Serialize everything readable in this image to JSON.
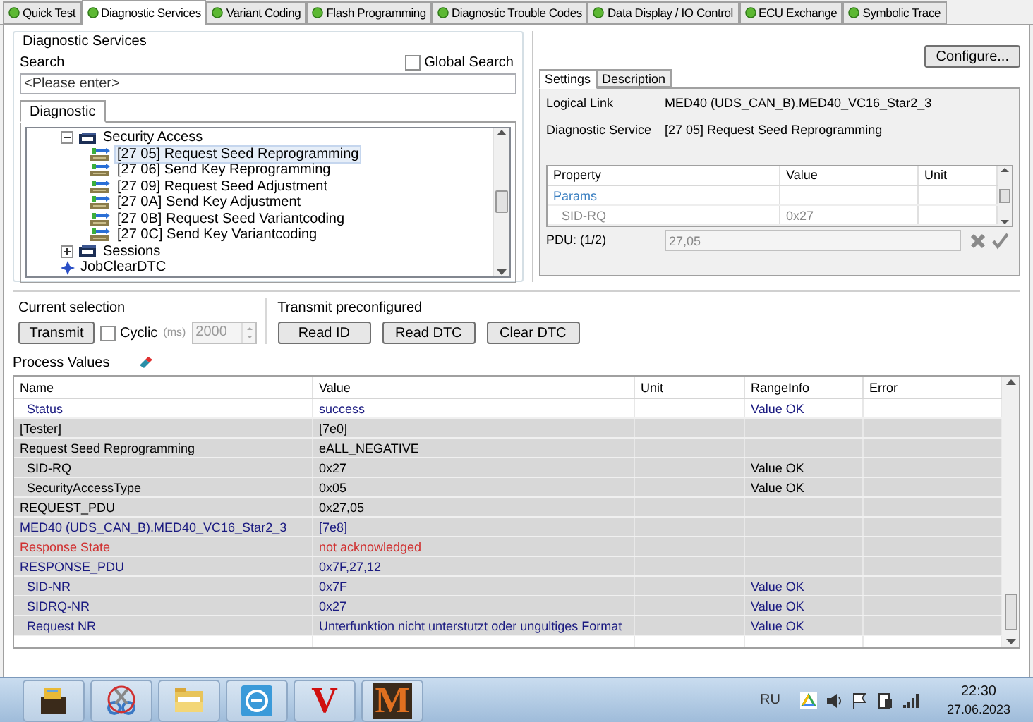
{
  "tabs": [
    {
      "label": "Quick Test",
      "selected": false
    },
    {
      "label": "Diagnostic Services",
      "selected": true
    },
    {
      "label": "Variant Coding",
      "selected": false
    },
    {
      "label": "Flash Programming",
      "selected": false
    },
    {
      "label": "Diagnostic Trouble Codes",
      "selected": false
    },
    {
      "label": "Data Display / IO Control",
      "selected": false
    },
    {
      "label": "ECU Exchange",
      "selected": false
    },
    {
      "label": "Symbolic Trace",
      "selected": false
    }
  ],
  "services": {
    "title": "Diagnostic Services",
    "search_label": "Search",
    "global_search": {
      "label": "Global Search",
      "checked": false
    },
    "search_placeholder": "<Please enter>",
    "tree_tab": "Diagnostic",
    "tree": [
      {
        "label": "Security Access",
        "kind": "folder",
        "expanded": true,
        "children": [
          {
            "label": "[27 05] Request Seed Reprogramming",
            "kind": "service",
            "selected": true
          },
          {
            "label": "[27 06] Send Key Reprogramming",
            "kind": "service",
            "selected": false
          },
          {
            "label": "[27 09] Request Seed Adjustment",
            "kind": "service",
            "selected": false
          },
          {
            "label": "[27 0A] Send Key Adjustment",
            "kind": "service",
            "selected": false
          },
          {
            "label": "[27 0B] Request Seed Variantcoding",
            "kind": "service",
            "selected": false
          },
          {
            "label": "[27 0C] Send Key Variantcoding",
            "kind": "service",
            "selected": false
          }
        ]
      },
      {
        "label": "Sessions",
        "kind": "folder",
        "expanded": false
      },
      {
        "label": "JobClearDTC",
        "kind": "job"
      }
    ]
  },
  "details": {
    "configure": "Configure...",
    "tabs": [
      {
        "label": "Settings",
        "selected": true
      },
      {
        "label": "Description",
        "selected": false
      }
    ],
    "fields": [
      {
        "label": "Logical Link",
        "value": "MED40 (UDS_CAN_B).MED40_VC16_Star2_3"
      },
      {
        "label": "Diagnostic Service",
        "value": "[27 05] Request Seed Reprogramming"
      }
    ],
    "grid": {
      "columns": [
        "Property",
        "Value",
        "Unit"
      ],
      "rows": [
        {
          "kind": "category",
          "cells": [
            "Params",
            "",
            ""
          ]
        },
        {
          "kind": "param",
          "cells": [
            "SID-RQ",
            "0x27",
            ""
          ]
        }
      ]
    },
    "pdu_label": "PDU: (1/2)",
    "pdu_value": "27,05"
  },
  "current_selection": {
    "title": "Current selection",
    "transmit": "Transmit",
    "cyclic": {
      "label": "Cyclic",
      "checked": false
    },
    "unit": "(ms)",
    "interval": "2000"
  },
  "preconfigured": {
    "title": "Transmit preconfigured",
    "buttons": [
      "Read ID",
      "Read DTC",
      "Clear DTC"
    ]
  },
  "process_values": {
    "title": "Process Values",
    "columns": [
      "Name",
      "Value",
      "Unit",
      "RangeInfo",
      "Error"
    ],
    "rows": [
      {
        "kind": "param",
        "shaded": false,
        "color": "#1a1a80",
        "cells": [
          "Status",
          "success",
          "",
          "Value OK",
          ""
        ]
      },
      {
        "kind": "group",
        "shaded": true,
        "color": "#000000",
        "cells": [
          "[Tester]",
          "[7e0]",
          "",
          "",
          ""
        ]
      },
      {
        "kind": "group",
        "shaded": true,
        "color": "#000000",
        "cells": [
          "Request Seed Reprogramming",
          "eALL_NEGATIVE",
          "",
          "",
          ""
        ]
      },
      {
        "kind": "param",
        "shaded": true,
        "color": "#000000",
        "cells": [
          "SID-RQ",
          "0x27",
          "",
          "Value OK",
          ""
        ]
      },
      {
        "kind": "param",
        "shaded": true,
        "color": "#000000",
        "cells": [
          "SecurityAccessType",
          "0x05",
          "",
          "Value OK",
          ""
        ]
      },
      {
        "kind": "group",
        "shaded": true,
        "color": "#000000",
        "cells": [
          "REQUEST_PDU",
          "0x27,05",
          "",
          "",
          ""
        ]
      },
      {
        "kind": "group",
        "shaded": true,
        "color": "#1a1a80",
        "cells": [
          "MED40 (UDS_CAN_B).MED40_VC16_Star2_3",
          "[7e8]",
          "",
          "",
          ""
        ]
      },
      {
        "kind": "group",
        "shaded": true,
        "color": "#d03030",
        "cells": [
          "Response State",
          "not acknowledged",
          "",
          "",
          ""
        ]
      },
      {
        "kind": "group",
        "shaded": true,
        "color": "#1a1a80",
        "cells": [
          "RESPONSE_PDU",
          "0x7F,27,12",
          "",
          "",
          ""
        ]
      },
      {
        "kind": "param",
        "shaded": true,
        "color": "#1a1a80",
        "cells": [
          "SID-NR",
          "0x7F",
          "",
          "Value OK",
          ""
        ]
      },
      {
        "kind": "param",
        "shaded": true,
        "color": "#1a1a80",
        "cells": [
          "SIDRQ-NR",
          "0x27",
          "",
          "Value OK",
          ""
        ]
      },
      {
        "kind": "param",
        "shaded": true,
        "color": "#1a1a80",
        "cells": [
          "Request NR",
          "Unterfunktion nicht unterstutzt oder ungultiges Format",
          "",
          "Value OK",
          ""
        ]
      }
    ]
  },
  "taskbar": {
    "apps": [
      {
        "kind": "toolbox"
      },
      {
        "kind": "scissors"
      },
      {
        "kind": "folder"
      },
      {
        "kind": "minus"
      },
      {
        "kind": "letter",
        "label": "V"
      },
      {
        "kind": "letter",
        "label": "M"
      }
    ],
    "language": "RU",
    "time": "22:30",
    "date": "27.06.2023"
  }
}
